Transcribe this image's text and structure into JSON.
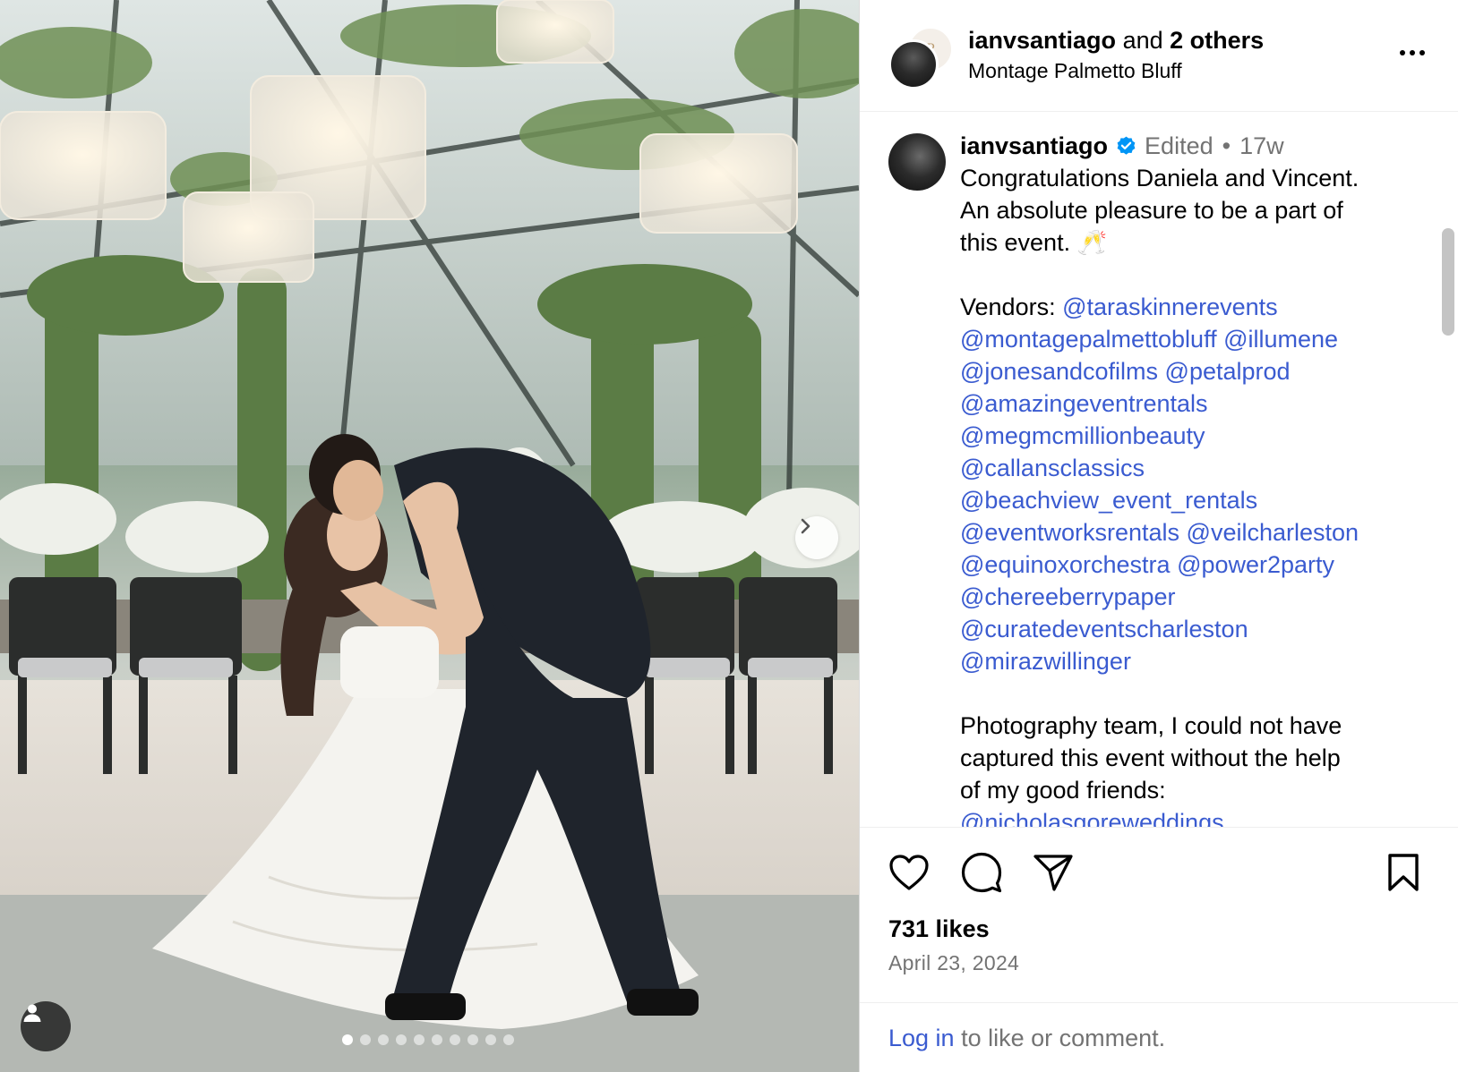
{
  "post": {
    "header": {
      "username": "ianvsantiago",
      "and_text": "and",
      "collaborators": "2 others",
      "location": "Montage Palmetto Bluff",
      "secondary_avatar_monogram": "P"
    },
    "caption": {
      "username": "ianvsantiago",
      "verified": true,
      "edited_label": "Edited",
      "separator": "•",
      "age": "17w",
      "lines": [
        "Congratulations Daniela and Vincent.",
        "An absolute pleasure to be a part of",
        "this event. 🥂"
      ],
      "vendors_label": "Vendors:",
      "vendor_lines": [
        [
          "@taraskinnerevents"
        ],
        [
          "@montagepalmettobluff",
          "@illumene"
        ],
        [
          "@jonesandcofilms",
          "@petalprod"
        ],
        [
          "@amazingeventrentals"
        ],
        [
          "@megmcmillionbeauty"
        ],
        [
          "@callansclassics"
        ],
        [
          "@beachview_event_rentals"
        ],
        [
          "@eventworksrentals",
          "@veilcharleston"
        ],
        [
          "@equinoxorchestra",
          "@power2party"
        ],
        [
          "@chereeberrypaper"
        ],
        [
          "@curatedeventscharleston"
        ],
        [
          "@mirazwillinger"
        ]
      ],
      "photo_lines": [
        "Photography team, I could not have",
        "captured this event without the help",
        "of my good friends:"
      ],
      "photo_mention": "@nicholasgoreweddings"
    },
    "likes": "731 likes",
    "date": "April 23, 2024",
    "login": {
      "link": "Log in",
      "rest": " to like or comment."
    },
    "carousel": {
      "count": 10,
      "active_index": 0
    },
    "icons": {
      "like": "heart-icon",
      "comment": "comment-icon",
      "share": "share-icon",
      "save": "bookmark-icon",
      "more": "more-icon",
      "next": "chevron-right-icon",
      "tags": "person-icon"
    },
    "colors": {
      "link": "#3a5bd0",
      "secondary_text": "#737373",
      "verified": "#0095f6"
    }
  }
}
